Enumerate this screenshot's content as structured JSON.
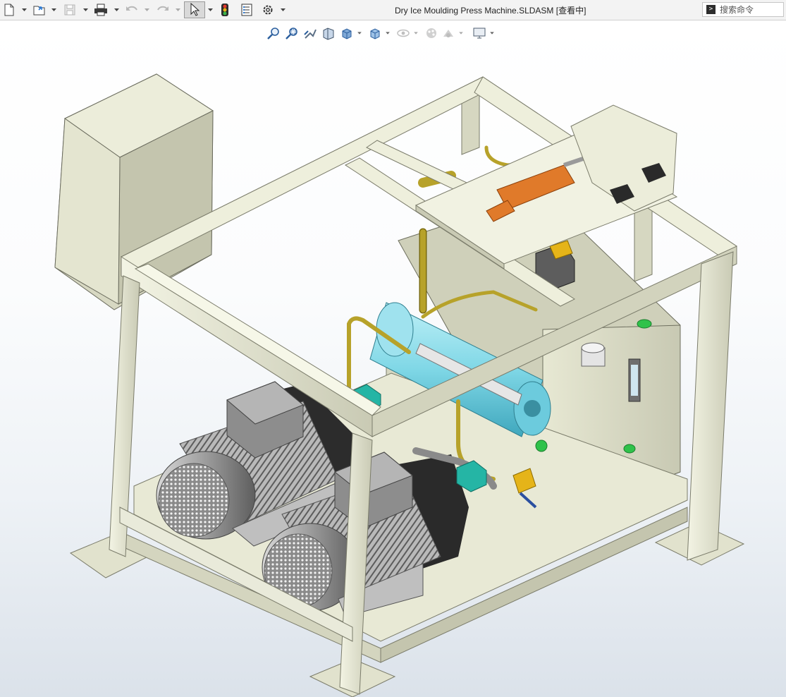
{
  "window": {
    "title": "Dry Ice Moulding Press Machine.SLDASM [查看中]"
  },
  "toolbar": {
    "items": [
      {
        "name": "new-document-icon"
      },
      {
        "name": "open-folder-icon"
      },
      {
        "name": "save-icon"
      },
      {
        "name": "print-icon"
      },
      {
        "name": "undo-icon"
      },
      {
        "name": "redo-icon"
      },
      {
        "name": "select-pointer-icon"
      },
      {
        "name": "traffic-light-icon"
      },
      {
        "name": "file-properties-icon"
      },
      {
        "name": "gear-icon"
      }
    ],
    "search": {
      "placeholder": "搜索命令",
      "icon": "command-prompt-icon"
    }
  },
  "heads_up_view_toolbar": {
    "items": [
      {
        "name": "zoom-to-fit-icon"
      },
      {
        "name": "zoom-to-area-icon"
      },
      {
        "name": "previous-view-icon"
      },
      {
        "name": "section-view-icon"
      },
      {
        "name": "view-orientation-icon"
      },
      {
        "name": "display-style-icon"
      },
      {
        "name": "hide-show-items-icon"
      },
      {
        "name": "edit-appearance-icon"
      },
      {
        "name": "apply-scene-icon"
      },
      {
        "name": "view-settings-icon"
      }
    ]
  },
  "model": {
    "name": "Dry Ice Moulding Press Machine",
    "colors": {
      "frame": "#edeedb",
      "frame_shade": "#c9cab4",
      "frame_dark": "#a7a893",
      "motor_grey": "#9a9a9a",
      "hydraulic_cyan": "#7fd7e6",
      "pipe_brass": "#b7a22a",
      "cylinder_orange": "#e07a2a",
      "valve_teal": "#25b5a5",
      "fitting_green": "#2fc24a"
    }
  }
}
